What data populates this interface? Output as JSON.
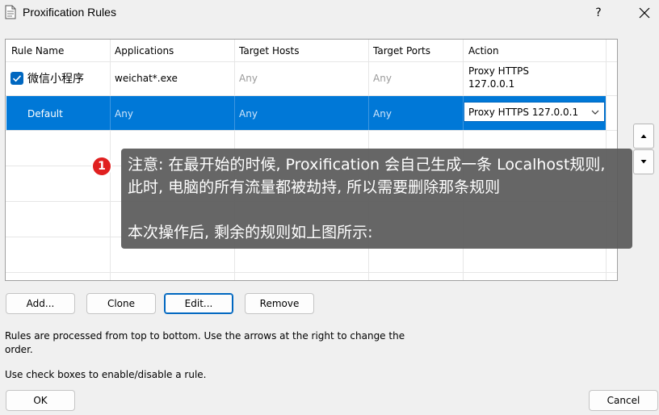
{
  "window": {
    "title": "Proxification Rules",
    "help_label": "?",
    "icons": {
      "app": "rules-document-icon",
      "close": "close-icon"
    }
  },
  "table": {
    "columns": [
      "Rule Name",
      "Applications",
      "Target Hosts",
      "Target Ports",
      "Action"
    ],
    "rows": [
      {
        "checked": true,
        "name": "微信小程序",
        "applications": "weichat*.exe",
        "hosts": "Any",
        "ports": "Any",
        "action_line1": "Proxy HTTPS",
        "action_line2": "127.0.0.1"
      },
      {
        "selected": true,
        "name": "Default",
        "applications": "Any",
        "hosts": "Any",
        "ports": "Any",
        "action": "Proxy HTTPS 127.0.0.1"
      }
    ],
    "selection_color": "#0078d7"
  },
  "buttons": {
    "add": "Add...",
    "clone": "Clone",
    "edit": "Edit...",
    "remove": "Remove",
    "ok": "OK",
    "cancel": "Cancel",
    "move_up_icon": "triangle-up-icon",
    "move_down_icon": "triangle-down-icon"
  },
  "info": {
    "line1": "Rules are processed from top to bottom. Use the arrows at the right to change the",
    "line2": "order.",
    "line3": "Use check boxes to enable/disable a rule."
  },
  "annotation": {
    "badge": "1",
    "line1": "注意: 在最开始的时候, Proxification 会自己生成一条 Localhost规则,",
    "line2": "此时, 电脑的所有流量都被劫持, 所以需要删除那条规则",
    "line3": "本次操作后, 剩余的规则如上图所示:",
    "badge_color": "#e02020"
  }
}
